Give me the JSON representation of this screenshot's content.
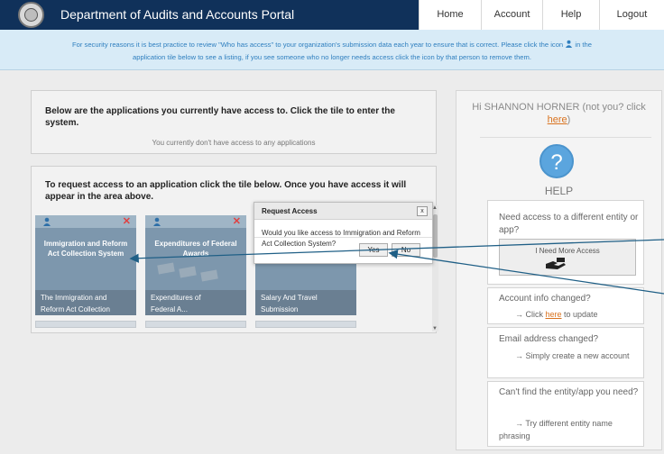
{
  "header": {
    "title": "Department of Audits and Accounts Portal",
    "nav": [
      "Home",
      "Account",
      "Help",
      "Logout"
    ]
  },
  "notice": {
    "line1": "For security reasons it is best practice to review \"Who has access\" to your organization's submission data each year to ensure that is correct. Please click the icon",
    "line1_tail": "in the",
    "line2": "application tile below to see a listing, if you see someone who no longer needs access click the icon by that person to remove them."
  },
  "apps_panel": {
    "heading": "Below are the applications you currently have access to. Click the tile to enter the system.",
    "empty_text": "You currently don't have access to any applications"
  },
  "request_panel": {
    "heading": "To request access to an application click the tile below. Once you have access it will appear in the area above.",
    "tiles": [
      {
        "name": "Immigration and Reform Act Collection System",
        "desc": "The Immigration and",
        "desc2": "Reform Act Collection"
      },
      {
        "name": "Expenditures of Federal Awards",
        "desc": "Expenditures of",
        "desc2": "Federal A..."
      },
      {
        "name": "",
        "desc": "Salary And Travel",
        "desc2": "Submission"
      }
    ]
  },
  "modal": {
    "title": "Request Access",
    "close": "x",
    "body": "Would you like access to Immigration and Reform Act Collection System?",
    "yes": "Yes",
    "no": "No"
  },
  "sidebar": {
    "greet_prefix": "Hi SHANNON HORNER (not you? click",
    "greet_link": "here",
    "greet_suffix": ")",
    "help_symbol": "?",
    "help_title": "HELP",
    "card1_q": "Need access to a different entity or app?",
    "card1_btn": "I Need More Access",
    "card2_q": "Account info changed?",
    "card2_a_pre": "→ Click ",
    "card2_a_link": "here",
    "card2_a_post": " to update",
    "card3_q": "Email address changed?",
    "card3_a": "→ Simply create a new account",
    "card4_q": "Can't find the entity/app you need?",
    "card4_a": "→ Try different entity name phrasing"
  },
  "colors": {
    "header_bg": "#10315a",
    "notice_bg": "#d8ebf7",
    "notice_text": "#2f7fbf",
    "tile_bg": "#7d97ad",
    "link": "#d9721e",
    "help_icon": "#5ba5de"
  }
}
